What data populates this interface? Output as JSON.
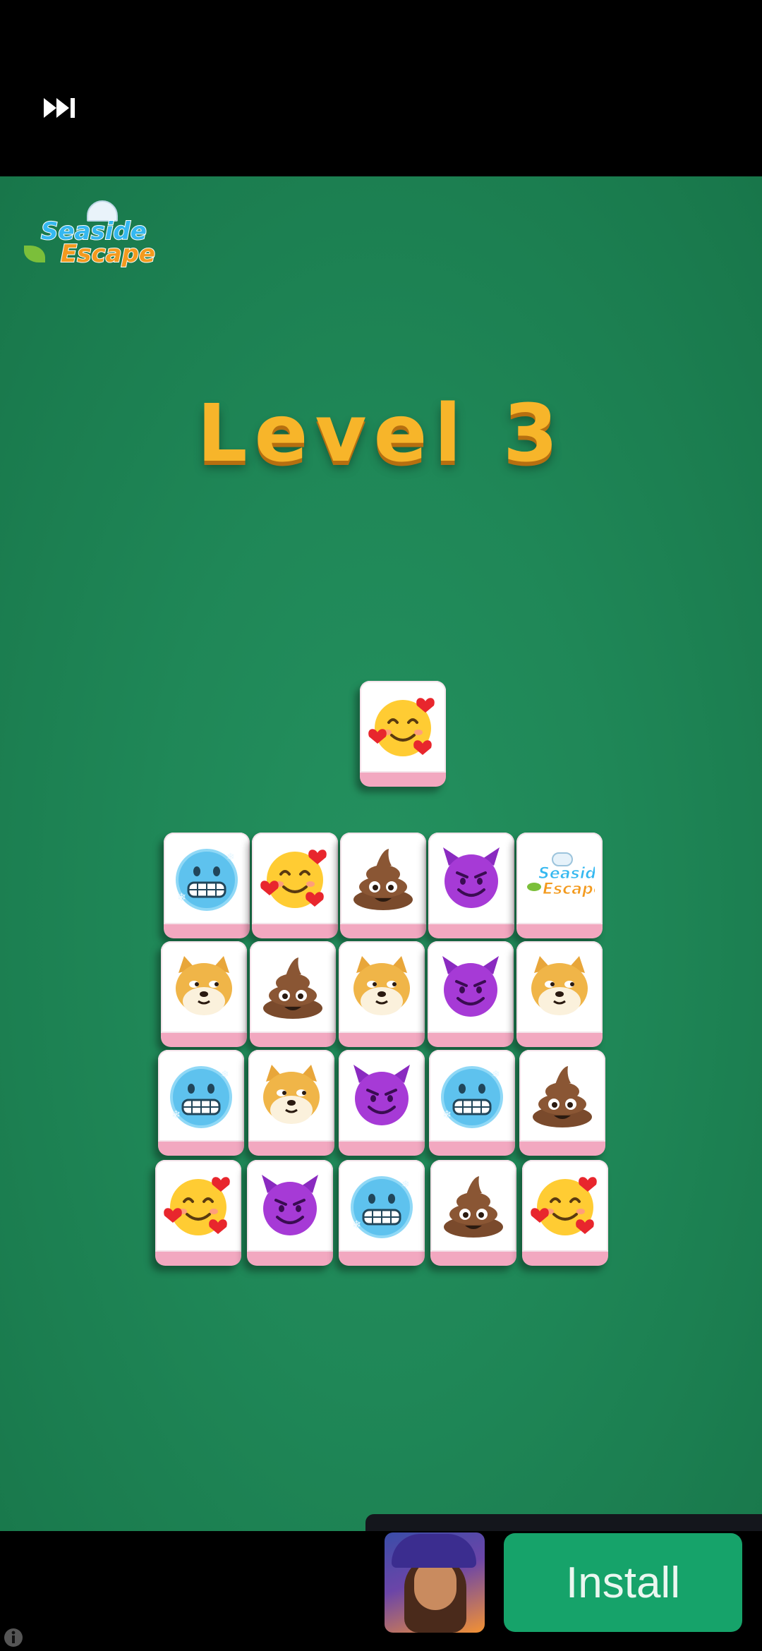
{
  "level": {
    "title": "Level 3"
  },
  "logo": {
    "line1": "Seaside",
    "line2": "Escape"
  },
  "icons": {
    "skip": "fast-forward-icon",
    "info": "info-icon"
  },
  "selected_tile": "smiling-hearts",
  "board": {
    "rows": [
      [
        "cold-face",
        "smiling-hearts",
        "poop",
        "smiling-devil",
        "seaside-escape-logo"
      ],
      [
        "doge",
        "poop",
        "doge",
        "smiling-devil",
        "doge"
      ],
      [
        "cold-face",
        "doge",
        "smiling-devil",
        "cold-face",
        "poop"
      ],
      [
        "smiling-hearts",
        "smiling-devil",
        "cold-face",
        "poop",
        "smiling-hearts"
      ]
    ]
  },
  "ad": {
    "install_label": "Install"
  },
  "colors": {
    "felt": "#1f8757",
    "level_text": "#f7b52a",
    "tile_base": "#f2a8c0",
    "install_button": "#16a36a"
  }
}
